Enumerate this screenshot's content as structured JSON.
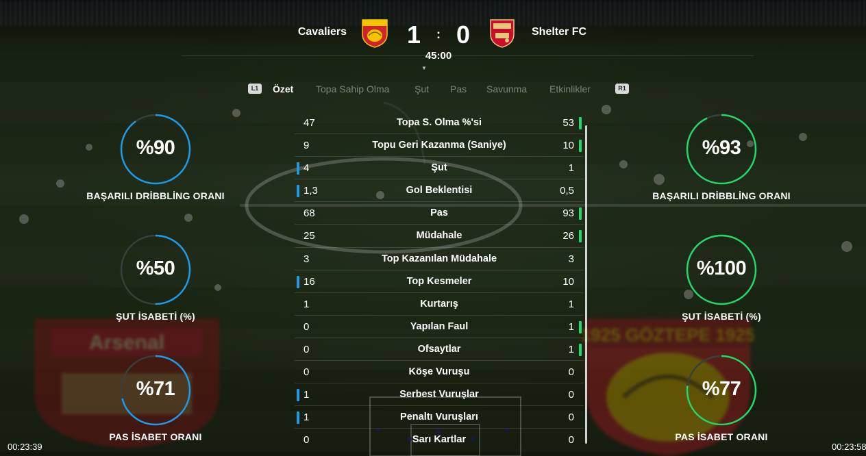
{
  "match": {
    "home_team": "Cavaliers",
    "away_team": "Shelter FC",
    "home_score": "1",
    "away_score": "0",
    "score_separator": ":",
    "clock": "45:00",
    "home_crest_text": "GÖZTEPE",
    "away_crest_text": "Arsenal"
  },
  "tabs": {
    "left_button": "L1",
    "right_button": "R1",
    "items": [
      {
        "label": "Özet",
        "active": true
      },
      {
        "label": "Topa Sahip Olma",
        "active": false
      },
      {
        "label": "Şut",
        "active": false
      },
      {
        "label": "Pas",
        "active": false
      },
      {
        "label": "Savunma",
        "active": false
      },
      {
        "label": "Etkinlikler",
        "active": false
      }
    ]
  },
  "home_rings": [
    {
      "value": "%90",
      "label": "BAŞARILI DRİBBLİNG ORANI",
      "percent": 90
    },
    {
      "value": "%50",
      "label": "ŞUT İSABETİ (%)",
      "percent": 50
    },
    {
      "value": "%71",
      "label": "PAS İSABET ORANI",
      "percent": 71
    }
  ],
  "away_rings": [
    {
      "value": "%93",
      "label": "BAŞARILI DRİBBLİNG ORANI",
      "percent": 93
    },
    {
      "value": "%100",
      "label": "ŞUT İSABETİ (%)",
      "percent": 100
    },
    {
      "value": "%77",
      "label": "PAS İSABET ORANI",
      "percent": 77
    }
  ],
  "stats": [
    {
      "name": "Topa S. Olma %'si",
      "home": "47",
      "away": "53",
      "leader": "away"
    },
    {
      "name": "Topu Geri Kazanma (Saniye)",
      "home": "9",
      "away": "10",
      "leader": "away"
    },
    {
      "name": "Şut",
      "home": "4",
      "away": "1",
      "leader": "home"
    },
    {
      "name": "Gol Beklentisi",
      "home": "1,3",
      "away": "0,5",
      "leader": "home"
    },
    {
      "name": "Pas",
      "home": "68",
      "away": "93",
      "leader": "away"
    },
    {
      "name": "Müdahale",
      "home": "25",
      "away": "26",
      "leader": "away"
    },
    {
      "name": "Top Kazanılan Müdahale",
      "home": "3",
      "away": "3",
      "leader": "none"
    },
    {
      "name": "Top Kesmeler",
      "home": "16",
      "away": "10",
      "leader": "home"
    },
    {
      "name": "Kurtarış",
      "home": "1",
      "away": "1",
      "leader": "none"
    },
    {
      "name": "Yapılan Faul",
      "home": "0",
      "away": "1",
      "leader": "away"
    },
    {
      "name": "Ofsaytlar",
      "home": "0",
      "away": "1",
      "leader": "away"
    },
    {
      "name": "Köşe Vuruşu",
      "home": "0",
      "away": "0",
      "leader": "none"
    },
    {
      "name": "Serbest Vuruşlar",
      "home": "1",
      "away": "0",
      "leader": "home"
    },
    {
      "name": "Penaltı Vuruşları",
      "home": "1",
      "away": "0",
      "leader": "home"
    },
    {
      "name": "Sarı Kartlar",
      "home": "0",
      "away": "0",
      "leader": "none"
    }
  ],
  "timestamps": {
    "left": "00:23:39",
    "right": "00:23:58"
  },
  "colors": {
    "home_accent": "#1e9be6",
    "away_accent": "#22d86a",
    "ring_track": "#3a3f3a",
    "arsenal_red": "#c8102e",
    "goztepe_yellow": "#f5c400",
    "goztepe_red": "#d2232a"
  }
}
